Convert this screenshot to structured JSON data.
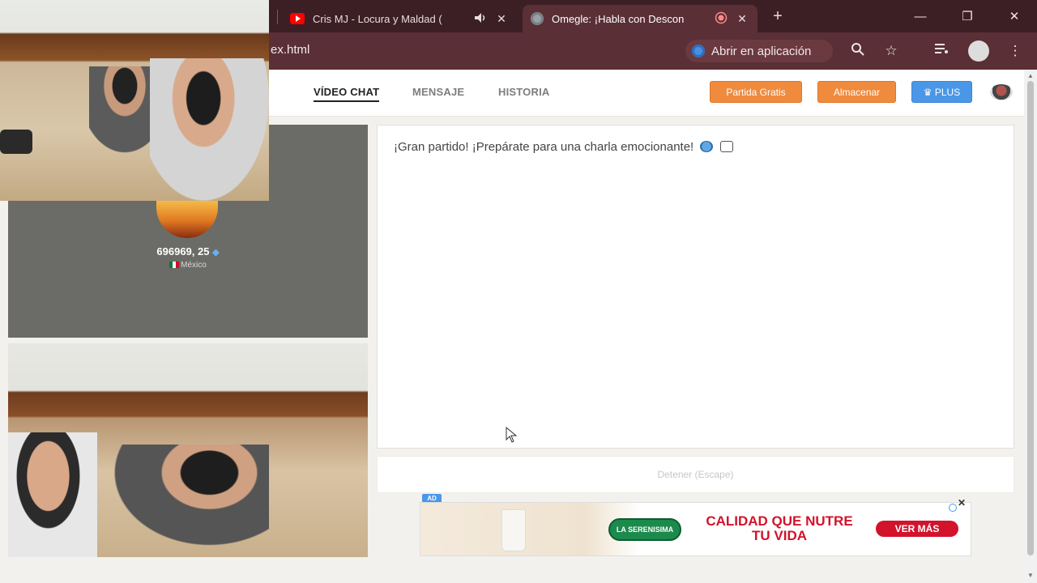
{
  "browser": {
    "tabs": [
      {
        "title": "Cris MJ - Locura y Maldad (",
        "favicon": "youtube-icon",
        "color": "#ff0000"
      },
      {
        "title": "Omegle: ¡Habla con Descon",
        "favicon": "globe-icon",
        "color": "#9aa0a6"
      }
    ],
    "url": "ex.html",
    "open_app_label": "Abrir en aplicación"
  },
  "site": {
    "nav": [
      {
        "label": "VÍDEO CHAT",
        "active": true
      },
      {
        "label": "MENSAJE",
        "active": false
      },
      {
        "label": "HISTORIA",
        "active": false
      }
    ],
    "buttons": {
      "partida": "Partida Gratis",
      "almacenar": "Almacenar",
      "plus": "PLUS"
    }
  },
  "stranger": {
    "name": "696969, 25",
    "country": "México"
  },
  "chat": {
    "message": "¡Gran partido! ¡Prepárate para una charla emocionante!"
  },
  "stop": {
    "label": "Detener (Escape)"
  },
  "ad": {
    "tag": "AD",
    "brand": "LA SERENISIMA",
    "headline": "CALIDAD QUE NUTRE TU VIDA",
    "cta": "VER MÁS",
    "colors": {
      "red": "#d3122b",
      "green": "#1c8a4c"
    }
  },
  "colors": {
    "tabbar": "#3b1f24",
    "toolbar": "#5a2f35",
    "orange": "#f08a3c",
    "blue": "#4a97e8"
  }
}
